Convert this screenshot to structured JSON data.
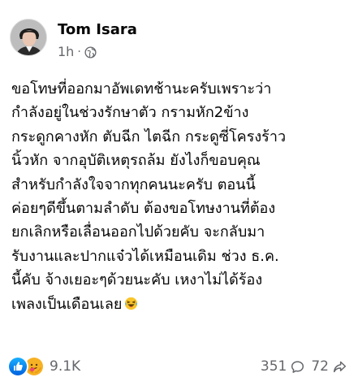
{
  "post": {
    "author_name": "Tom Isara",
    "timestamp": "1h",
    "separator": "·",
    "privacy_icon": "globe-icon",
    "text": "ขอโทษที่ออกมาอัพเดทช้านะครับเพราะว่า\nกำลังอยู่ในช่วงรักษาตัว กรามหัก2ข้าง\nกระดูกคางหัก ตับฉีก ไตฉีก กระดูซี่โครงร้าว\nนิ้วหัก จากอุบัติเหตุรถล้ม ยังไงก็ขอบคุณ\nสำหรับกำลังใจจากทุกคนนะครับ ตอนนี้\nค่อยๆดีขึ้นตามลำดับ ต้องขอโทษงานที่ต้อง\nยกเลิกหรือเลื่อนออกไปด้วยคับ จะกลับมา\nรับงานและปากแจ๋วได้เหมือนเดิม ช่วง ธ.ค.\nนี้คับ จ้างเยอะๆด้วยนะคับ เหงาไม่ได้ร้อง\nเพลงเป็นเดือนเลย",
    "trailing_emoji": "laughing-crying-emoji"
  },
  "reactions": {
    "icons": [
      "like-icon",
      "care-icon"
    ],
    "count": "9.1K"
  },
  "stats": {
    "comments_count": "351",
    "shares_count": "72"
  },
  "colors": {
    "like_blue": "#1877f2",
    "care_yellow": "#f7b125",
    "secondary_text": "#65676b",
    "primary_text": "#050505"
  }
}
